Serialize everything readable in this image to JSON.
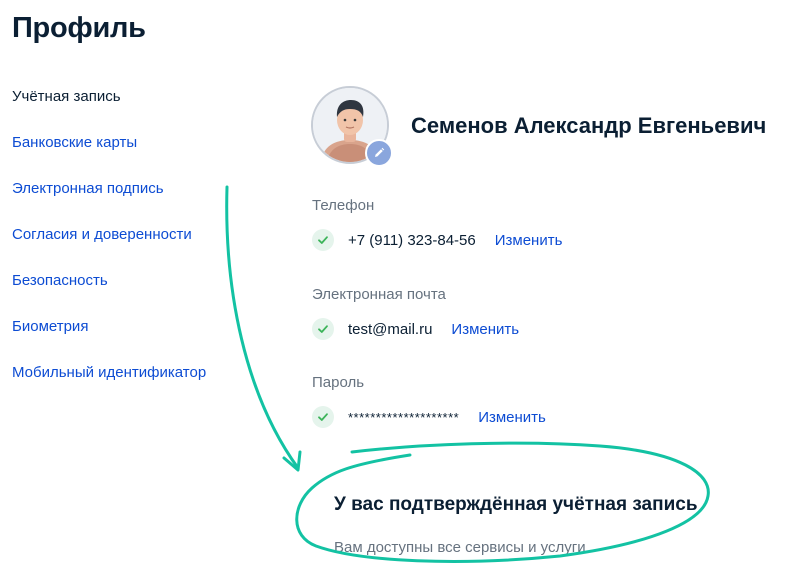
{
  "page": {
    "title": "Профиль"
  },
  "nav": {
    "items": [
      {
        "label": "Учётная запись",
        "active": true
      },
      {
        "label": "Банковские карты",
        "active": false
      },
      {
        "label": "Электронная подпись",
        "active": false
      },
      {
        "label": "Согласия и доверенности",
        "active": false
      },
      {
        "label": "Безопасность",
        "active": false
      },
      {
        "label": "Биометрия",
        "active": false
      },
      {
        "label": "Мобильный идентификатор",
        "active": false
      }
    ]
  },
  "profile": {
    "name": "Семенов Александр Евгеньевич",
    "fields": [
      {
        "label": "Телефон",
        "value": "+7 (911) 323-84-56",
        "action": "Изменить"
      },
      {
        "label": "Электронная почта",
        "value": "test@mail.ru",
        "action": "Изменить"
      },
      {
        "label": "Пароль",
        "value": "********************",
        "action": "Изменить"
      }
    ]
  },
  "status": {
    "title": "У вас подтверждённая учётная запись",
    "text": "Вам доступны все сервисы и услуги"
  },
  "colors": {
    "text": "#0b1f33",
    "link": "#0d4cd3",
    "muted": "#66727f",
    "success": "#3cb45a",
    "annotation": "#13c2a3"
  },
  "icons": {
    "check": "check-icon",
    "edit": "pencil-icon",
    "avatar": "avatar-icon"
  }
}
